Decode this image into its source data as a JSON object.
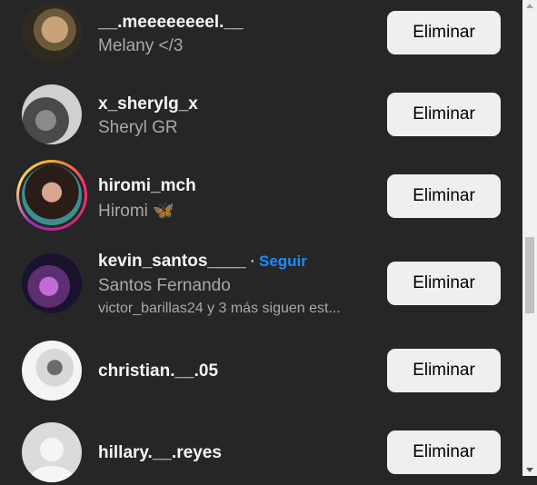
{
  "rows": [
    {
      "username": "__.meeeeeeeel.__",
      "fullname": "Melany </3",
      "button": "Eliminar"
    },
    {
      "username": "x_sherylg_x",
      "fullname": "Sheryl GR",
      "button": "Eliminar"
    },
    {
      "username": "hiromi_mch",
      "fullname": "Hiromi 🦋",
      "button": "Eliminar"
    },
    {
      "username": "kevin_santos____",
      "separator": "·",
      "follow": "Seguir",
      "fullname": "Santos Fernando",
      "mutual": "victor_barillas24 y 3 más siguen est...",
      "button": "Eliminar"
    },
    {
      "username": "christian.__.05",
      "fullname": "",
      "button": "Eliminar"
    },
    {
      "username": "hillary.__.reyes",
      "fullname": "",
      "button": "Eliminar"
    }
  ],
  "colors": {
    "background": "#262626",
    "button_bg": "#efefef",
    "follow_link": "#1a8cff",
    "story_ring": "#d62976"
  }
}
